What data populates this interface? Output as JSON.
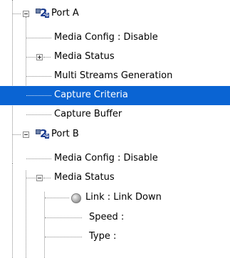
{
  "tree": {
    "port_a": {
      "label": "Port A",
      "expander": "collapse",
      "children": {
        "media_config": "Media Config : Disable",
        "media_status": "Media Status",
        "multi_streams": "Multi Streams Generation",
        "capture_criteria": "Capture Criteria",
        "capture_buffer": "Capture Buffer"
      }
    },
    "port_b": {
      "label": "Port B",
      "expander": "collapse",
      "children": {
        "media_config": "Media Config : Disable",
        "media_status": {
          "label": "Media Status",
          "expander": "collapse",
          "children": {
            "link": "Link : Link Down",
            "speed": "Speed :",
            "type": "Type :"
          }
        }
      }
    },
    "selected_item": "Capture Criteria",
    "selection_color": "#0a64d3",
    "icons": {
      "port": "port-icon",
      "link_status": "gray-status-ball-icon"
    }
  }
}
